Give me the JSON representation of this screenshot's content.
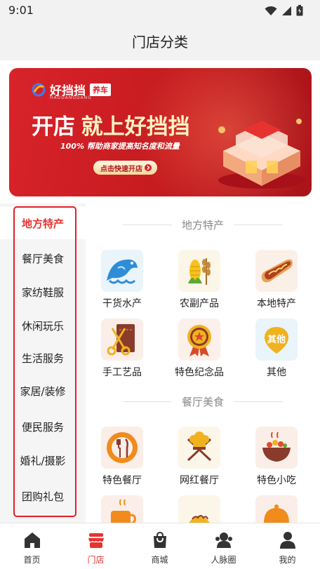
{
  "status_bar": {
    "time": "9:01"
  },
  "header": {
    "title": "门店分类"
  },
  "banner": {
    "brand": "好挡挡",
    "brand_tag": "养车",
    "brand_sub": "HAODANGDANG",
    "headline_lead": "开店",
    "headline_highlight": "就上好挡挡",
    "subline": "100% 帮助商家提高知名度和流量",
    "cta_label": "点击快速开店",
    "colors": {
      "banner_red": "#d8232a",
      "cta_gold": "#f4d59a"
    }
  },
  "sidebar": {
    "active_index": 0,
    "items": [
      {
        "label": "地方特产"
      },
      {
        "label": "餐厅美食"
      },
      {
        "label": "家纺鞋服"
      },
      {
        "label": "休闲玩乐"
      },
      {
        "label": "生活服务"
      },
      {
        "label": "家居/装修"
      },
      {
        "label": "便民服务"
      },
      {
        "label": "婚礼/摄影"
      },
      {
        "label": "团购礼包"
      }
    ]
  },
  "sections": [
    {
      "title": "地方特产",
      "items": [
        {
          "label": "干货水产",
          "icon": "fish-icon"
        },
        {
          "label": "农副产品",
          "icon": "corn-wheat-icon"
        },
        {
          "label": "本地特产",
          "icon": "sausage-icon"
        },
        {
          "label": "手工艺品",
          "icon": "scissors-icon"
        },
        {
          "label": "特色纪念品",
          "icon": "medal-icon"
        },
        {
          "label": "其他",
          "icon": "other-badge-icon",
          "badge_text": "其他"
        }
      ]
    },
    {
      "title": "餐厅美食",
      "items": [
        {
          "label": "特色餐厅",
          "icon": "plate-cutlery-icon"
        },
        {
          "label": "网红餐厅",
          "icon": "chef-hat-icon"
        },
        {
          "label": "特色小吃",
          "icon": "hot-bowl-icon"
        },
        {
          "label": "",
          "icon": "coffee-cup-icon"
        },
        {
          "label": "",
          "icon": "dumpling-icon"
        },
        {
          "label": "",
          "icon": "cloche-icon"
        }
      ]
    }
  ],
  "tabbar": {
    "active_index": 1,
    "items": [
      {
        "label": "首页",
        "icon": "home-icon"
      },
      {
        "label": "门店",
        "icon": "store-icon"
      },
      {
        "label": "商城",
        "icon": "shopping-bag-icon"
      },
      {
        "label": "人脉圈",
        "icon": "contacts-icon"
      },
      {
        "label": "我的",
        "icon": "profile-icon"
      }
    ]
  },
  "colors": {
    "accent": "#e8322f",
    "highlight_border": "#e41f25",
    "sidebar_bg": "#f5f5f5"
  }
}
